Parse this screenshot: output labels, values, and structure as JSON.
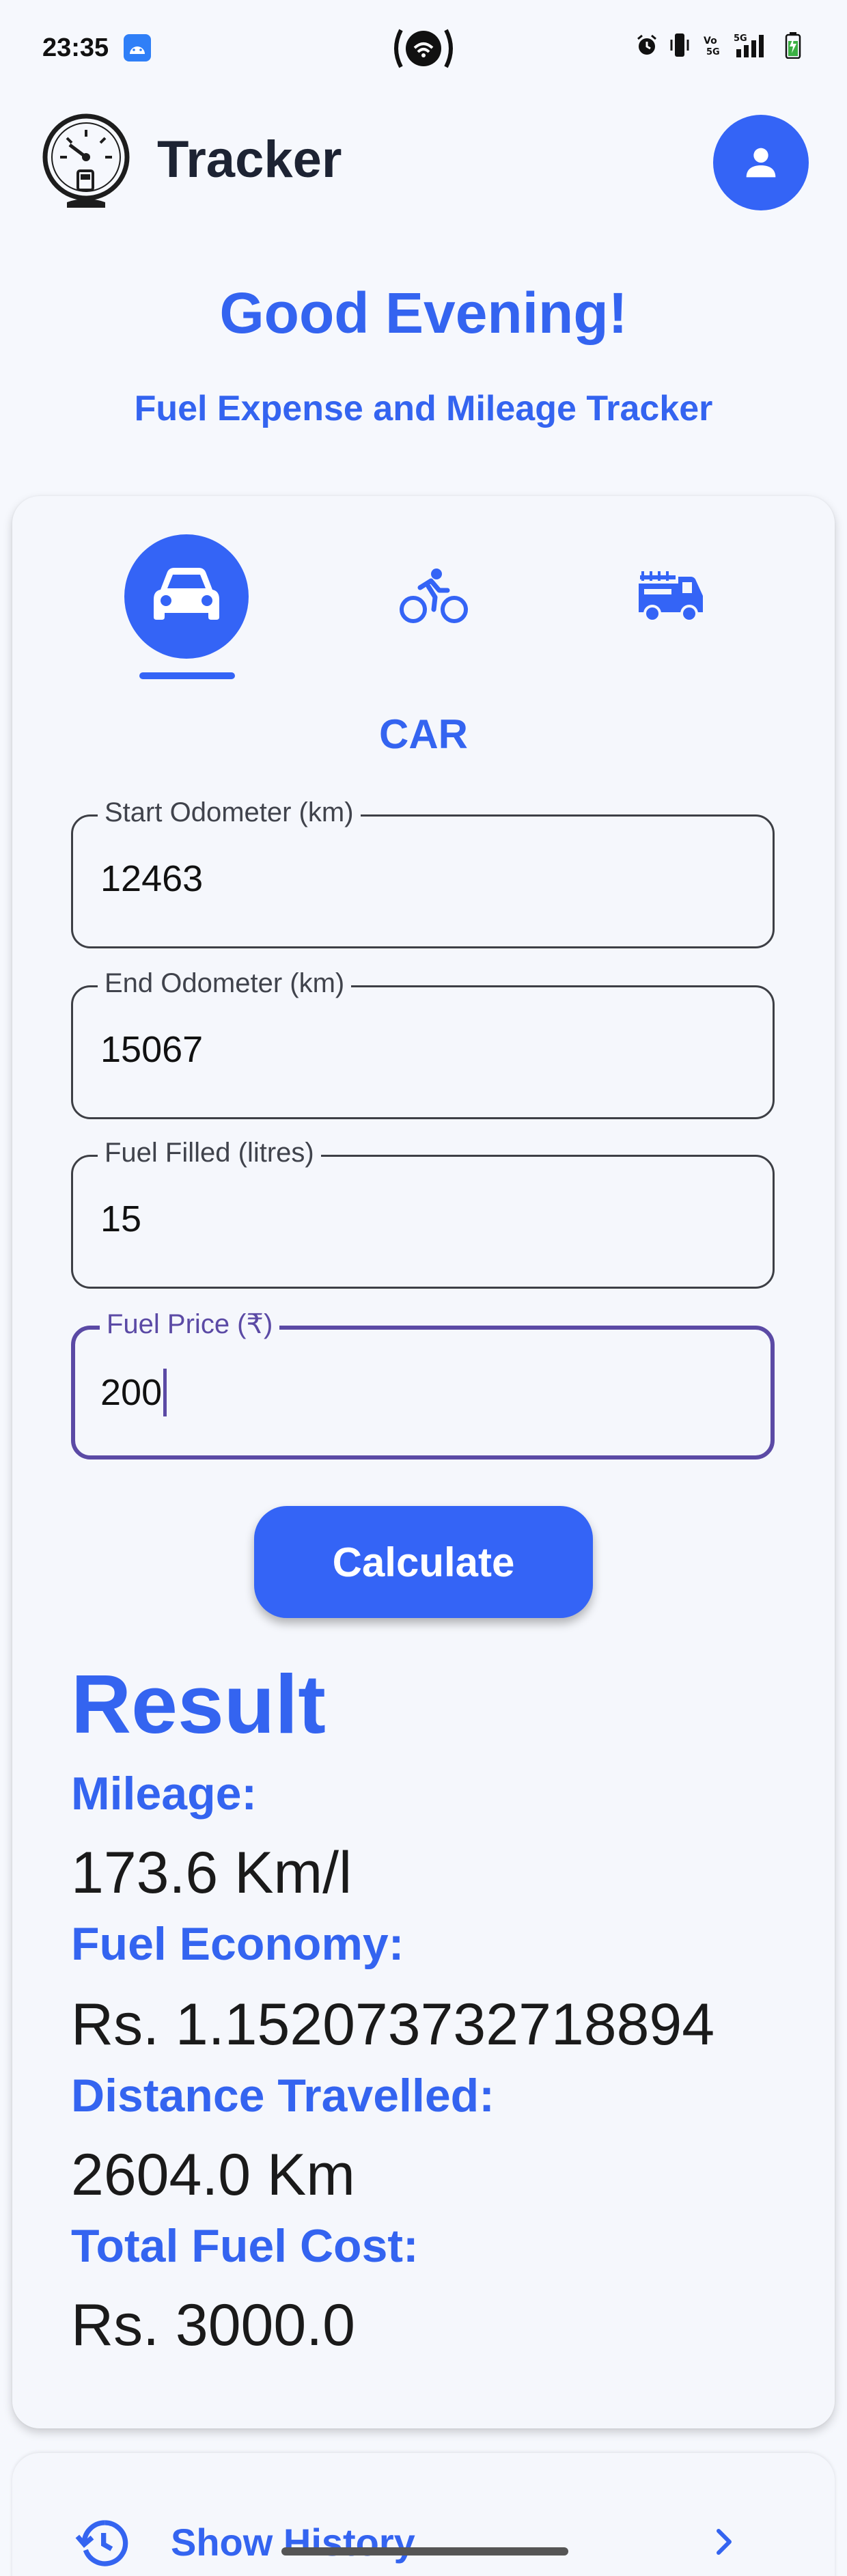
{
  "status_bar": {
    "time": "23:35",
    "icons": [
      "android-icon",
      "hotspot-icon",
      "alarm-icon",
      "vibrate-icon",
      "volte-icon",
      "5g-signal-icon",
      "battery-charging-icon"
    ]
  },
  "app_bar": {
    "title": "Tracker",
    "logo_icon": "fuel-gauge-icon",
    "profile_icon": "person-icon",
    "accent_color": "#3464f6"
  },
  "greeting": "Good Evening!",
  "subtitle": "Fuel Expense and Mileage Tracker",
  "vehicles": {
    "selected": "car",
    "options": [
      "car-icon",
      "bicycle-icon",
      "truck-icon"
    ],
    "selected_label": "CAR"
  },
  "form": {
    "start_odometer": {
      "label": "Start Odometer (km)",
      "value": "12463"
    },
    "end_odometer": {
      "label": "End Odometer (km)",
      "value": "15067"
    },
    "fuel_filled": {
      "label": "Fuel Filled (litres)",
      "value": "15"
    },
    "fuel_price": {
      "label": "Fuel Price (₹)",
      "value": "200",
      "focused": true
    },
    "focus_color": "#5b4aa5"
  },
  "calculate_label": "Calculate",
  "result": {
    "heading": "Result",
    "mileage_label": "Mileage:",
    "mileage_value": "173.6 Km/l",
    "economy_label": "Fuel Economy:",
    "economy_value": "Rs. 1.152073732718894",
    "distance_label": "Distance Travelled:",
    "distance_value": "2604.0 Km",
    "cost_label": "Total Fuel Cost:",
    "cost_value": "Rs. 3000.0"
  },
  "history": {
    "label": "Show History",
    "icon": "history-icon",
    "chevron": "chevron-right-icon"
  }
}
